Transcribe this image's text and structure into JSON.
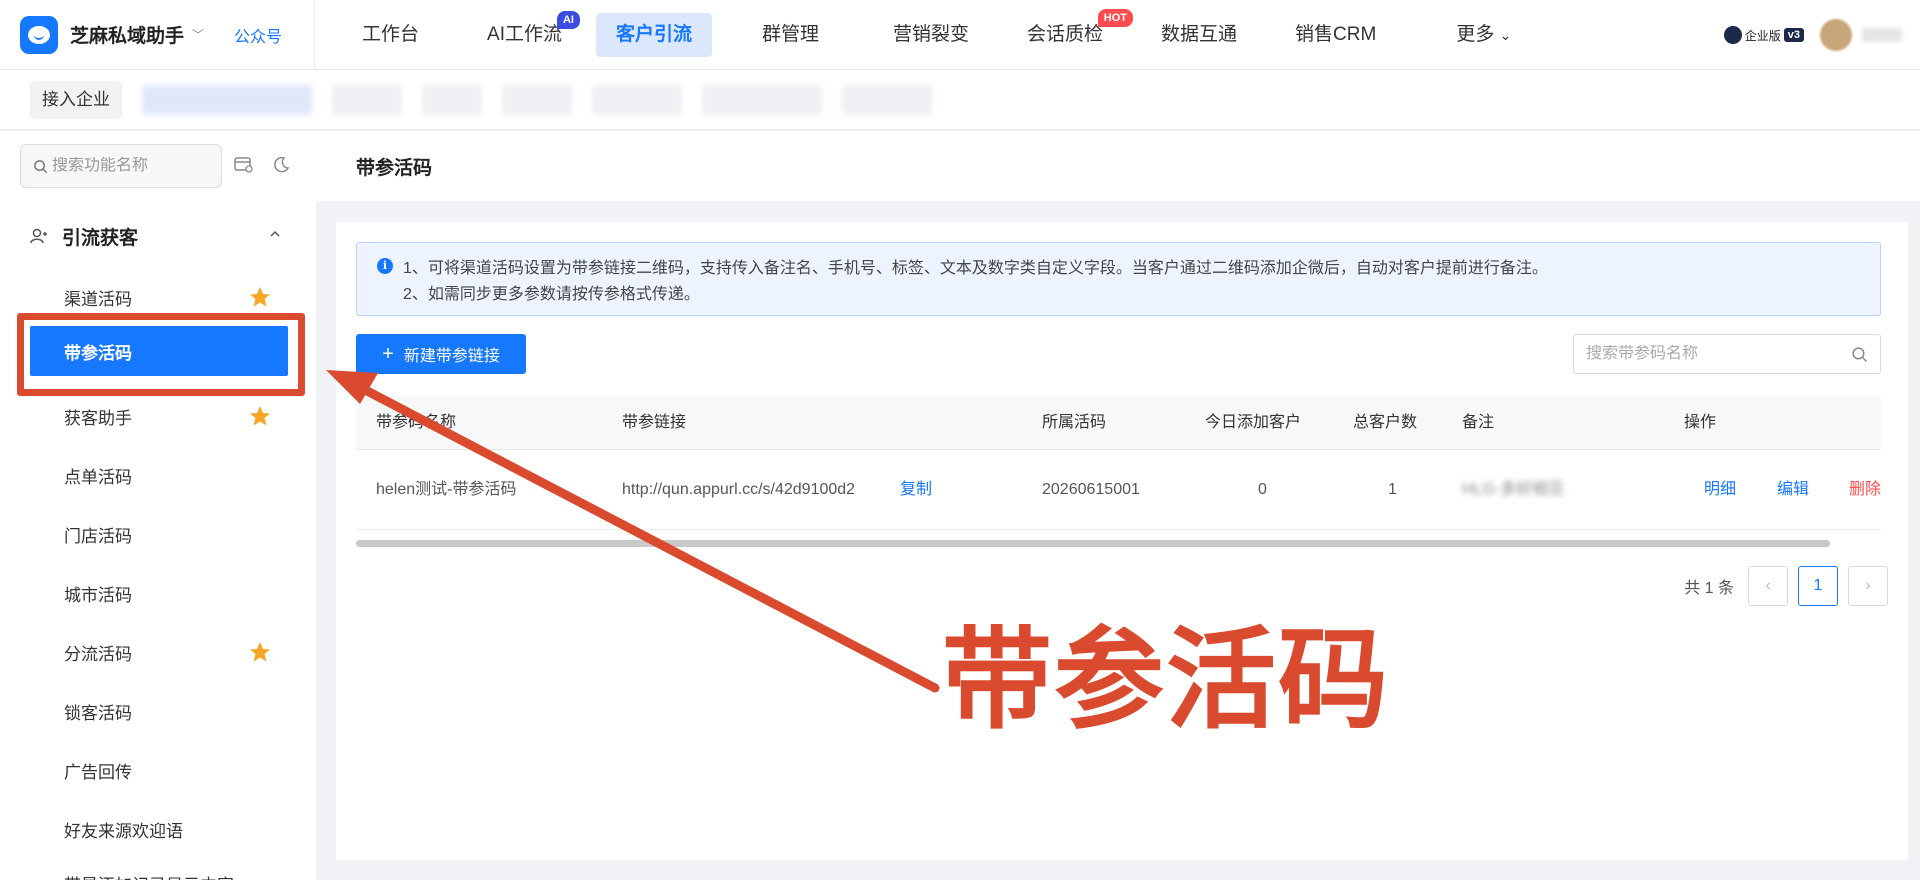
{
  "brand": {
    "name": "芝麻私域助手",
    "tag": "公众号"
  },
  "nav": {
    "items": [
      {
        "label": "工作台",
        "badge": null
      },
      {
        "label": "AI工作流",
        "badge": "AI"
      },
      {
        "label": "客户引流",
        "badge": null,
        "active": true
      },
      {
        "label": "群管理",
        "badge": null
      },
      {
        "label": "营销裂变",
        "badge": null
      },
      {
        "label": "会话质检",
        "badge": "HOT"
      },
      {
        "label": "数据互通",
        "badge": null
      },
      {
        "label": "销售CRM",
        "badge": null
      },
      {
        "label": "更多",
        "badge": null
      }
    ],
    "more_caret": "⌄",
    "edition": "企业版",
    "version": "v3",
    "colors": {
      "accent": "#1677ff",
      "active_bg": "#dbe8fb",
      "ai_badge": "#3b4de0",
      "hot_badge": "#ff4d4f"
    }
  },
  "secondbar": {
    "join_label": "接入企业"
  },
  "sidebar": {
    "search_placeholder": "搜索功能名称",
    "group_label": "引流获客",
    "items": [
      {
        "label": "渠道活码",
        "starred": true
      },
      {
        "label": "带参活码",
        "active": true
      },
      {
        "label": "获客助手",
        "starred": true
      },
      {
        "label": "点单活码"
      },
      {
        "label": "门店活码"
      },
      {
        "label": "城市活码"
      },
      {
        "label": "分流活码",
        "starred": true
      },
      {
        "label": "锁客活码"
      },
      {
        "label": "广告回传"
      },
      {
        "label": "好友来源欢迎语"
      },
      {
        "label": "带是添加记录显示内容"
      }
    ]
  },
  "page": {
    "title": "带参活码",
    "alert_lines": [
      "1、可将渠道活码设置为带参链接二维码，支持传入备注名、手机号、标签、文本及数字类自定义字段。当客户通过二维码添加企微后，自动对客户提前进行备注。",
      "2、如需同步更多参数请按传参格式传递。"
    ],
    "new_button": "新建带参链接",
    "search_placeholder": "搜索带参码名称",
    "table": {
      "columns": [
        "带参码名称",
        "带参链接",
        "所属活码",
        "今日添加客户",
        "总客户数",
        "备注",
        "操作"
      ],
      "rows": [
        {
          "name": "helen测试-带参活码",
          "link": "http://qun.appurl.cc/s/42d9100d2",
          "copy": "复制",
          "code": "20260615001",
          "today": "0",
          "total": "1",
          "remark": "HLG-多好相见",
          "actions": [
            "明细",
            "编辑",
            "删除"
          ]
        }
      ]
    },
    "pagination": {
      "total_text": "共 1 条",
      "current": "1",
      "prev": "‹",
      "next": "›"
    }
  },
  "annotation": {
    "text": "带参活码",
    "color": "#d94a2e"
  }
}
